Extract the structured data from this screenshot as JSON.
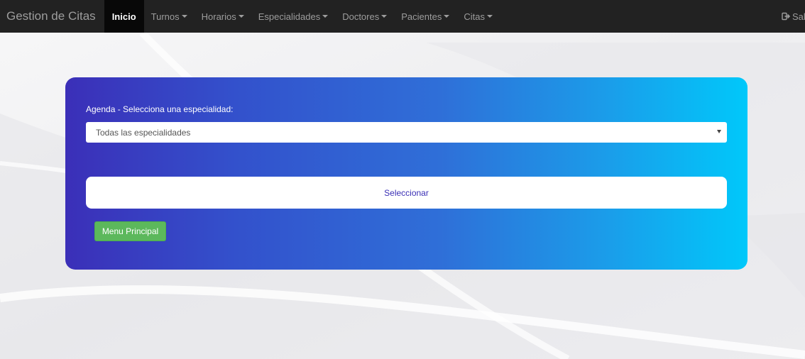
{
  "navbar": {
    "brand": "Gestion de Citas",
    "items": [
      {
        "label": "Inicio",
        "active": true,
        "dropdown": false
      },
      {
        "label": "Turnos",
        "active": false,
        "dropdown": true
      },
      {
        "label": "Horarios",
        "active": false,
        "dropdown": true
      },
      {
        "label": "Especialidades",
        "active": false,
        "dropdown": true
      },
      {
        "label": "Doctores",
        "active": false,
        "dropdown": true
      },
      {
        "label": "Pacientes",
        "active": false,
        "dropdown": true
      },
      {
        "label": "Citas",
        "active": false,
        "dropdown": true
      }
    ],
    "logout_label": "Salir",
    "logout_icon": "logout-icon"
  },
  "agenda": {
    "label": "Agenda - Selecciona una especialidad:",
    "selected_value": "Todas las especialidades",
    "select_button_label": "Seleccionar",
    "menu_button_label": "Menu Principal"
  },
  "colors": {
    "navbar_bg": "#222222",
    "panel_gradient_start": "#3b2fb8",
    "panel_gradient_end": "#00c8fa",
    "success_button": "#5cb85c"
  }
}
